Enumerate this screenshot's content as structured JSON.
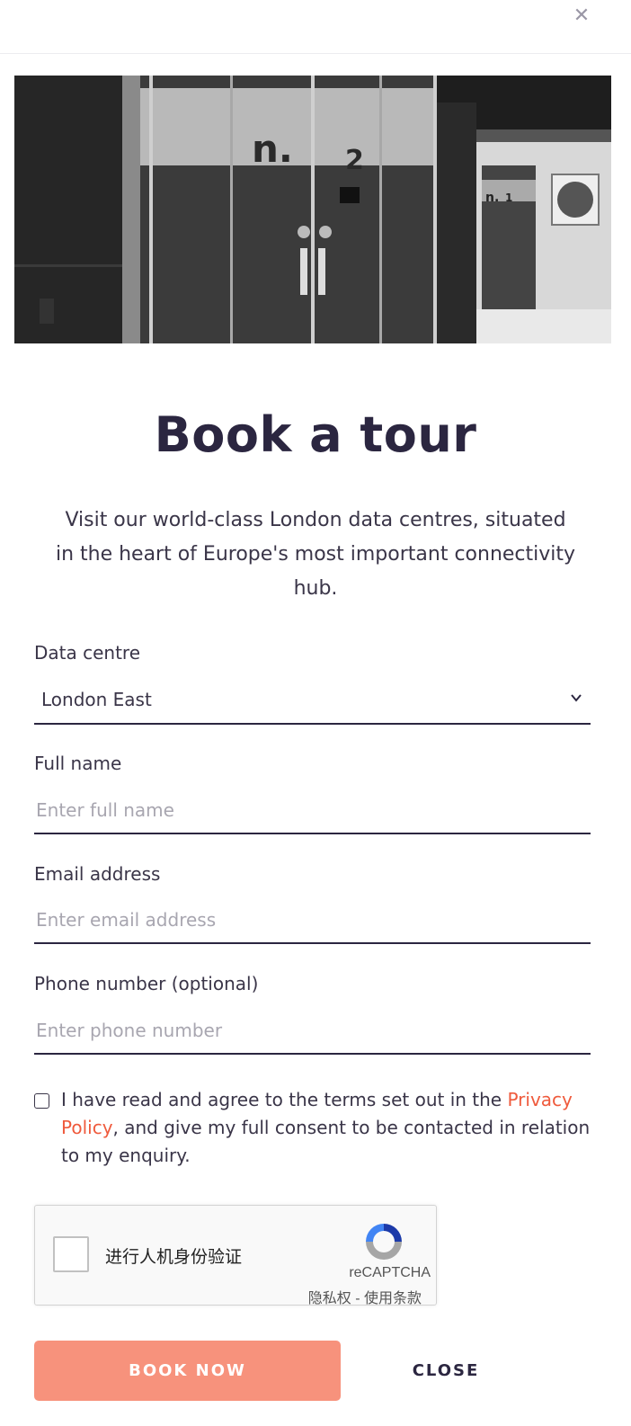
{
  "modal": {
    "close_icon": "close-icon",
    "hero_image": "data-centre-hall-photo",
    "hero_marks": [
      "n.",
      "2",
      "n.",
      "1"
    ],
    "title": "Book a tour",
    "intro": "Visit our world-class London data centres, situated in the heart of Europe's most important connectivity hub."
  },
  "form": {
    "data_centre": {
      "label": "Data centre",
      "value": "London East",
      "icon": "chevron-down-icon"
    },
    "full_name": {
      "label": "Full name",
      "placeholder": "Enter full name",
      "value": ""
    },
    "email": {
      "label": "Email address",
      "placeholder": "Enter email address",
      "value": ""
    },
    "phone": {
      "label": "Phone number (optional)",
      "placeholder": "Enter phone number",
      "value": ""
    },
    "consent": {
      "checked": false,
      "text_before": "I have read and agree to the terms set out in the ",
      "link": "Privacy Policy",
      "text_after": ", and give my full consent to be contacted in relation to my enquiry."
    }
  },
  "recaptcha": {
    "label": "进行人机身份验证",
    "brand": "reCAPTCHA",
    "privacy": "隐私权",
    "separator": " - ",
    "terms": "使用条款"
  },
  "actions": {
    "book_label": "BOOK NOW",
    "close_label": "CLOSE"
  },
  "colors": {
    "heading": "#2b2640",
    "accent_link": "#ef5a3c",
    "book_button": "#f7927c"
  }
}
